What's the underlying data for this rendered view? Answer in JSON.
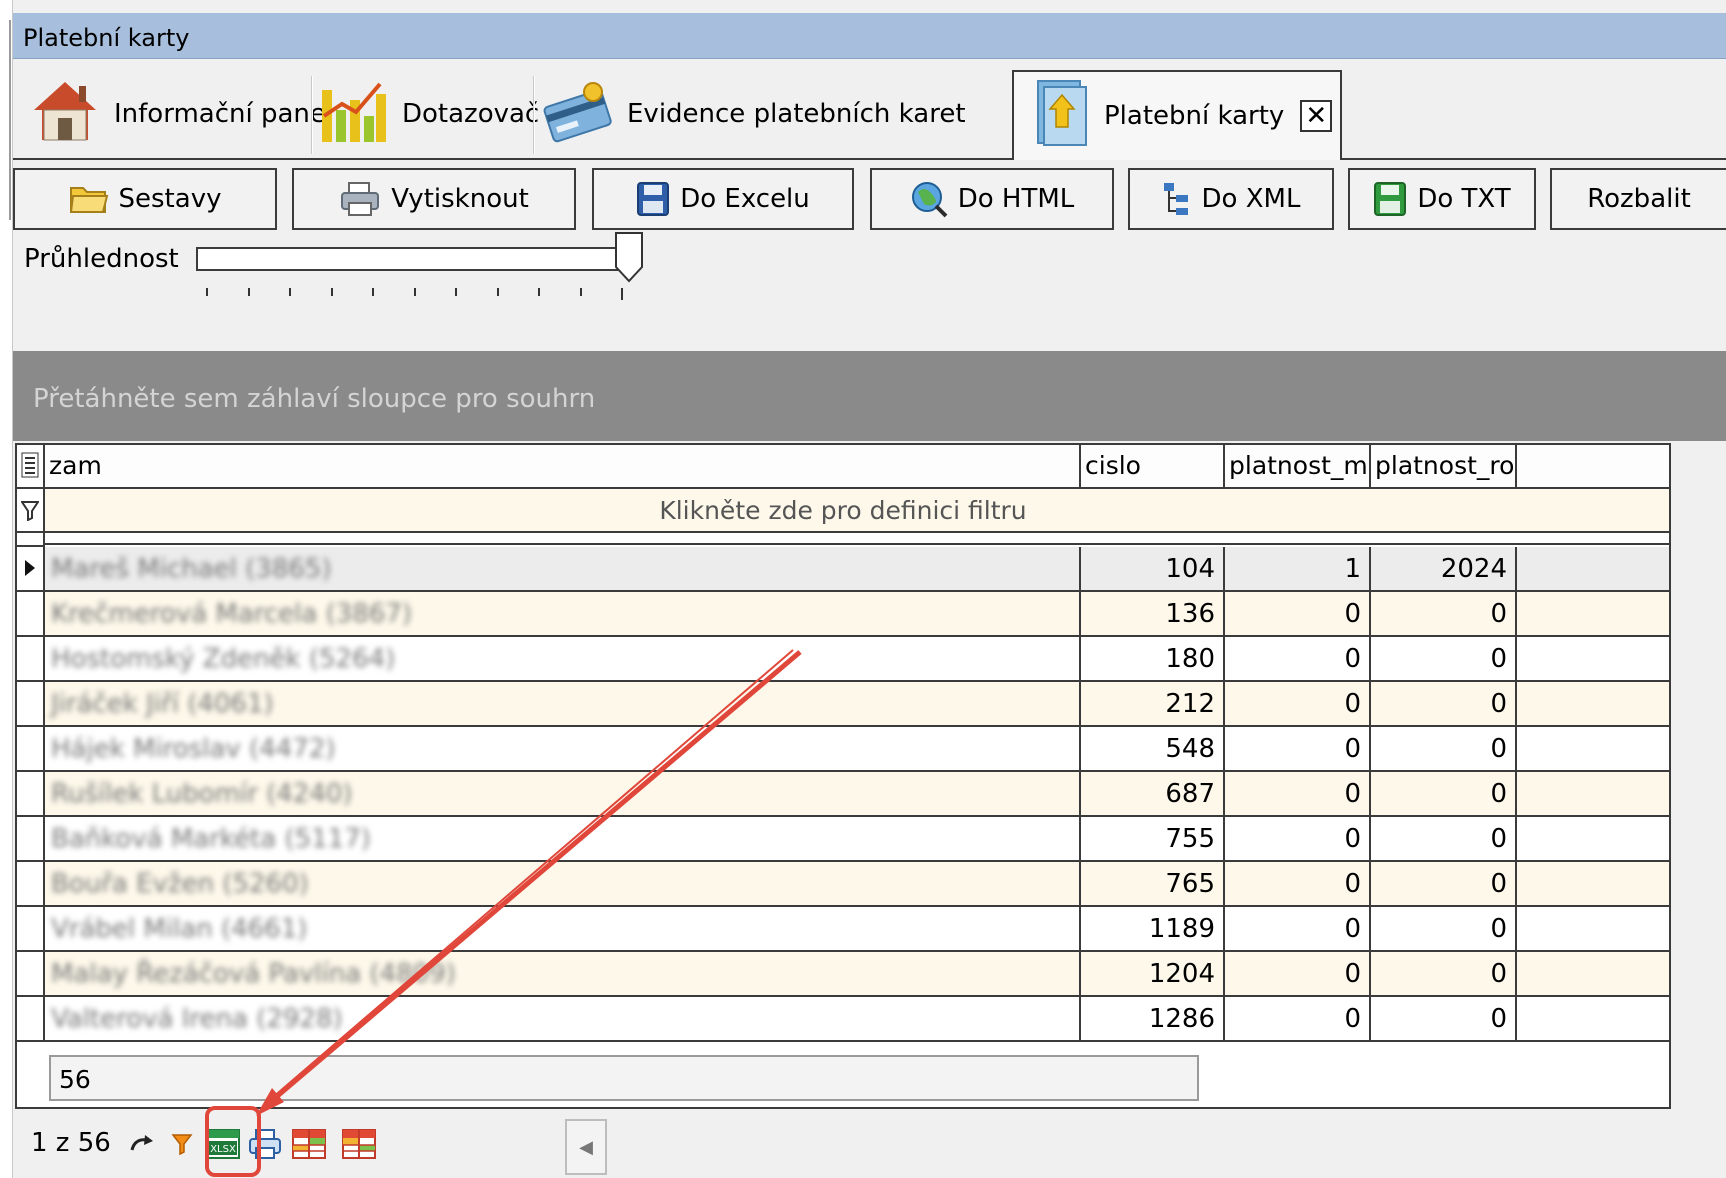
{
  "window": {
    "title": "Platební karty"
  },
  "tabs": [
    {
      "label": "Informační panel",
      "icon": "house-icon"
    },
    {
      "label": "Dotazovač",
      "icon": "bar-chart-icon"
    },
    {
      "label": "Evidence platebních karet",
      "icon": "payment-card-icon"
    },
    {
      "label": "Platební karty",
      "icon": "document-arrow-icon",
      "active": true,
      "close_glyph": "✕"
    }
  ],
  "toolbar": {
    "buttons": [
      {
        "label": "Sestavy",
        "icon": "folder-open-icon"
      },
      {
        "label": "Vytisknout",
        "icon": "printer-icon"
      },
      {
        "label": "Do Excelu",
        "icon": "floppy-disk-icon"
      },
      {
        "label": "Do HTML",
        "icon": "globe-icon"
      },
      {
        "label": "Do XML",
        "icon": "tree-icon"
      },
      {
        "label": "Do TXT",
        "icon": "floppy-disk-green-icon"
      },
      {
        "label": "Rozbalit",
        "icon": ""
      }
    ]
  },
  "transparency": {
    "label": "Průhlednost",
    "level": 1.0
  },
  "group_panel": {
    "hint": "Přetáhněte sem záhlaví sloupce pro souhrn"
  },
  "grid": {
    "columns": [
      "zam",
      "cislo",
      "platnost_me",
      "platnost_rok"
    ],
    "filter_hint": "Klikněte zde pro definici filtru",
    "rows": [
      {
        "zam": "Mareš Michael (3865)",
        "cislo": "104",
        "platnost_me": "1",
        "platnost_rok": "2024",
        "selected": true
      },
      {
        "zam": "Krečmerová Marcela (3867)",
        "cislo": "136",
        "platnost_me": "0",
        "platnost_rok": "0"
      },
      {
        "zam": "Hostomský Zdeněk (5264)",
        "cislo": "180",
        "platnost_me": "0",
        "platnost_rok": "0"
      },
      {
        "zam": "Jiráček Jiří (4061)",
        "cislo": "212",
        "platnost_me": "0",
        "platnost_rok": "0"
      },
      {
        "zam": "Hájek Miroslav (4472)",
        "cislo": "548",
        "platnost_me": "0",
        "platnost_rok": "0"
      },
      {
        "zam": "Rušílek Lubomír (4240)",
        "cislo": "687",
        "platnost_me": "0",
        "platnost_rok": "0"
      },
      {
        "zam": "Baňková Markéta (5117)",
        "cislo": "755",
        "platnost_me": "0",
        "platnost_rok": "0"
      },
      {
        "zam": "Bouřa Evžen (5260)",
        "cislo": "765",
        "platnost_me": "0",
        "platnost_rok": "0"
      },
      {
        "zam": "Vrábel Milan (4661)",
        "cislo": "1189",
        "platnost_me": "0",
        "platnost_rok": "0"
      },
      {
        "zam": "Malay Řezáčová Pavlína (4809)",
        "cislo": "1204",
        "platnost_me": "0",
        "platnost_rok": "0"
      },
      {
        "zam": "Valterová Irena (2928)",
        "cislo": "1286",
        "platnost_me": "0",
        "platnost_rok": "0"
      }
    ],
    "summary_count": "56"
  },
  "navigator": {
    "position": "1 z 56",
    "icons": [
      "refresh-icon",
      "filter-icon",
      "xlsx-export-icon",
      "printer-icon",
      "grid-layout-icon",
      "grid-layout-alt-icon"
    ],
    "scroll_glyph": "◀"
  },
  "colors": {
    "title_bar": "#a7bfdc",
    "group_panel": "#8a8a8a",
    "row_alt": "#fdf8ea",
    "annotation": "#e0473a"
  }
}
